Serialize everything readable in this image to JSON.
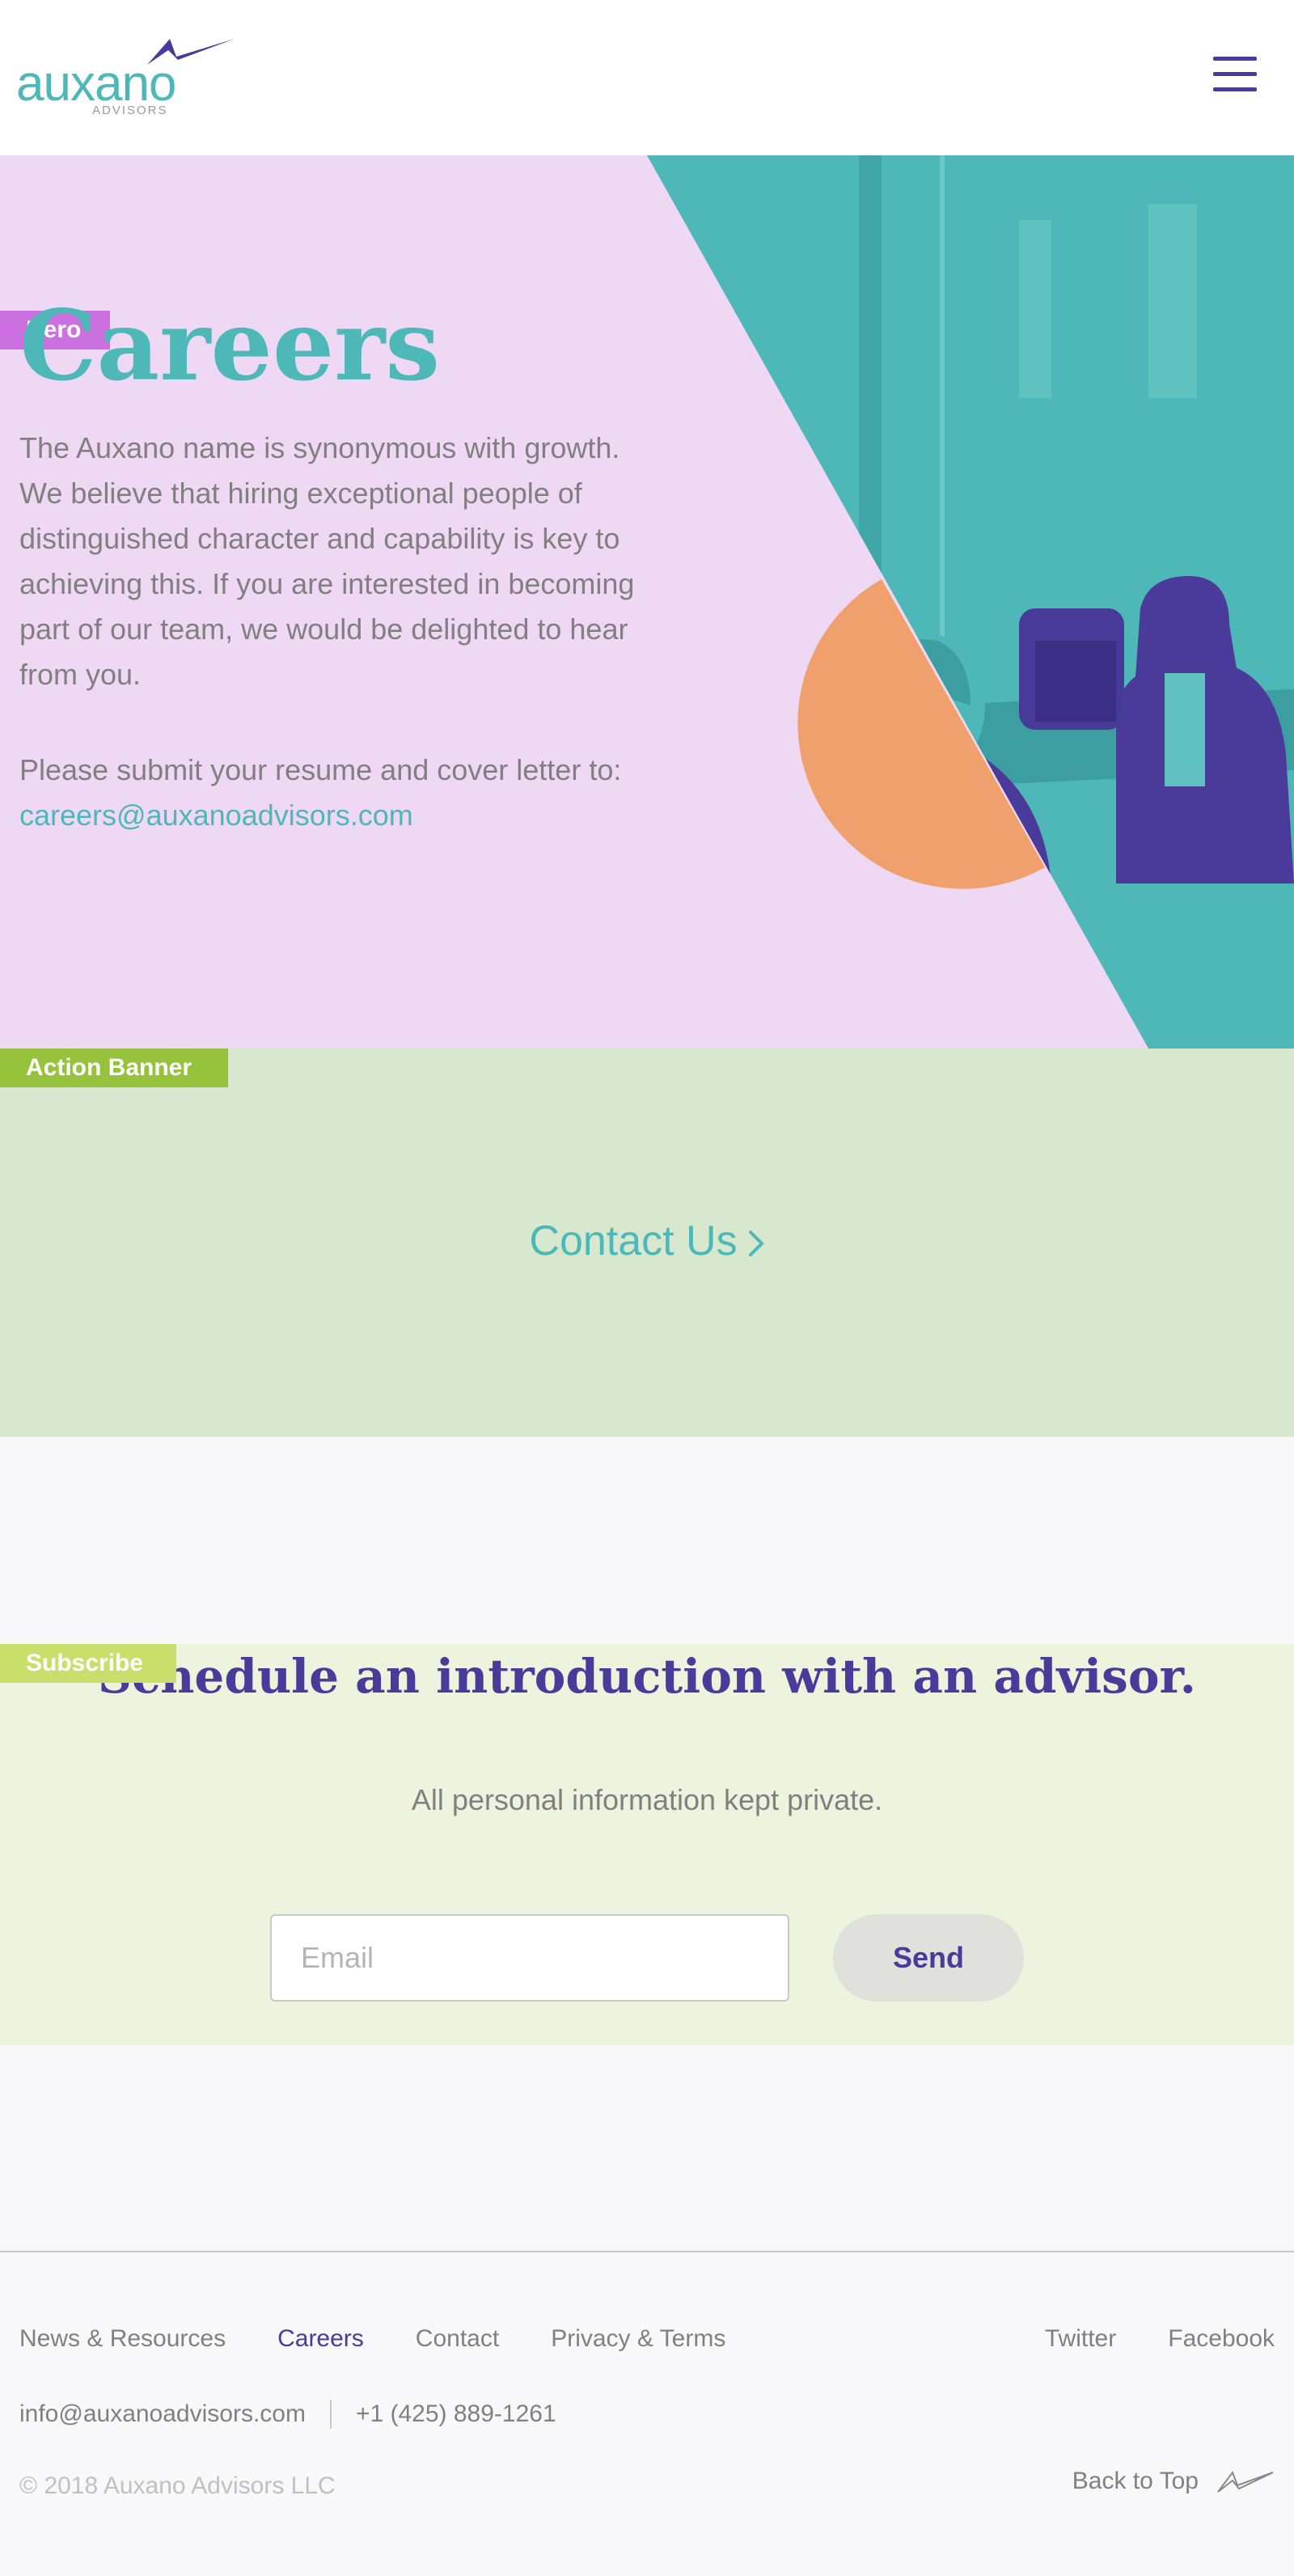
{
  "header": {
    "logo_word": "auxano",
    "logo_sub": "ADVISORS"
  },
  "hero": {
    "tag": "Hero",
    "title": "Careers",
    "paragraph": "The Auxano name is synonymous with growth. We believe that hiring exceptional people of distinguished character and capability is key to achieving this. If you are interested in becoming part of our team, we would be delighted to hear from you.",
    "submit_text": "Please submit your resume and cover letter to:",
    "email": "careers@auxanoadvisors.com"
  },
  "action_banner": {
    "tag": "Action Banner",
    "link_label": "Contact Us"
  },
  "subscribe": {
    "tag": "Subscribe",
    "title": "Schedule an introduction with an advisor.",
    "note": "All personal information kept private.",
    "email_placeholder": "Email",
    "send_label": "Send"
  },
  "footer": {
    "nav": [
      "News & Resources",
      "Careers",
      "Contact",
      "Privacy & Terms"
    ],
    "social": [
      "Twitter",
      "Facebook"
    ],
    "email": "info@auxanoadvisors.com",
    "phone": "+1 (425) 889-1261",
    "copyright": "© 2018 Auxano Advisors LLC",
    "back_to_top": "Back to Top"
  },
  "colors": {
    "teal": "#4eb8b8",
    "purple": "#4a3a9a",
    "lavender_bg": "#efd8f4",
    "orange": "#f0a06c",
    "action_bg": "#d8e8cf",
    "subscribe_bg": "#edf3dd"
  }
}
